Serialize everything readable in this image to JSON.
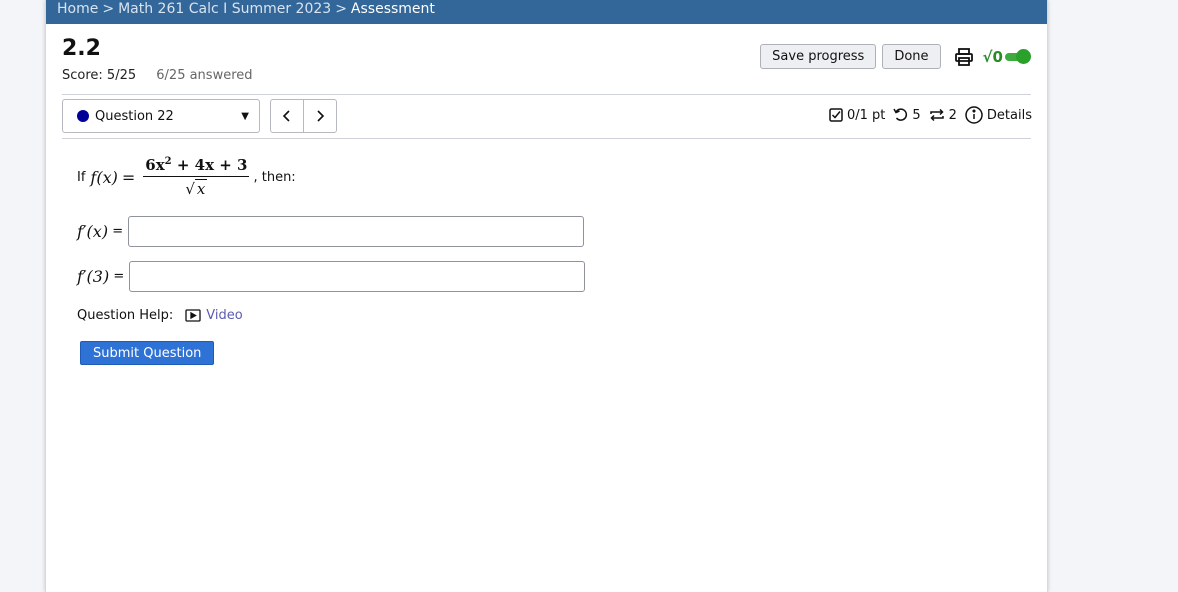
{
  "breadcrumb": {
    "home": "Home",
    "course": "Math 261 Calc I Summer 2023",
    "current": "Assessment",
    "separator": ">"
  },
  "assessment": {
    "title": "2.2",
    "score": "Score: 5/25",
    "answered": "6/25 answered"
  },
  "actions": {
    "save_label": "Save progress",
    "done_label": "Done",
    "math_toggle_glyph": "√0"
  },
  "question_nav": {
    "selected": "Question 22",
    "dot_color": "#000099"
  },
  "question_meta": {
    "points": "0/1 pt",
    "retries": "5",
    "versions": "2",
    "details_label": "Details"
  },
  "question": {
    "intro": "If",
    "func": "f(x)",
    "eq": "=",
    "numerator_a": "6x",
    "numerator_exp": "2",
    "numerator_b": " + 4x + 3",
    "denominator": "x",
    "suffix": ", then:",
    "answers": [
      {
        "label": "f′(x)",
        "eq": "=",
        "value": ""
      },
      {
        "label": "f′(3)",
        "eq": "=",
        "value": ""
      }
    ],
    "help_label": "Question Help:",
    "video_label": "Video",
    "submit_label": "Submit Question"
  },
  "colors": {
    "topbar": "#336699",
    "submit": "#2f72d5",
    "toggle": "#2aa12a",
    "link": "#5b5bb3"
  }
}
